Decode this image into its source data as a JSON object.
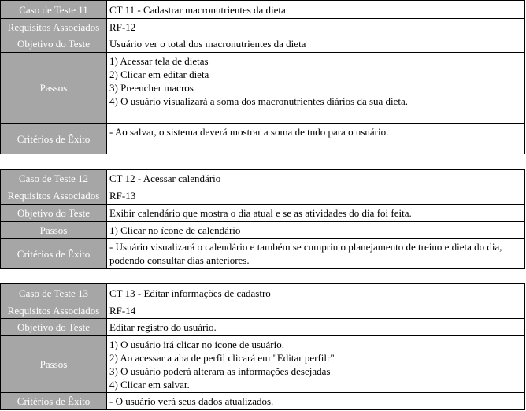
{
  "test_cases": [
    {
      "caso_label": "Caso de Teste 11",
      "caso_value": "CT 11 - Cadastrar macronutrientes da dieta",
      "requisitos_label": "Requisitos Associados",
      "requisitos_value": "RF-12",
      "objetivo_label": "Objetivo do Teste",
      "objetivo_value": "Usuário ver o total dos macronutrientes da dieta",
      "passos_label": "Passos",
      "passos": [
        "1) Acessar tela de dietas",
        "2) Clicar em editar dieta",
        "3) Preencher macros",
        "4) O usuário visualizará a soma dos macronutrientes diários da sua dieta."
      ],
      "criterios_label": "Critérios de Êxito",
      "criterios_value": "- Ao salvar, o sistema deverá mostrar a soma de tudo para o usuário."
    },
    {
      "caso_label": "Caso de Teste 12",
      "caso_value": "CT 12  - Acessar calendário",
      "requisitos_label": "Requisitos Associados",
      "requisitos_value": "RF-13",
      "objetivo_label": "Objetivo do Teste",
      "objetivo_value": "Exibir calendário que mostra o dia atual e se as atividades do dia foi feita.",
      "passos_label": "Passos",
      "passos": [
        "1) Clicar no ícone de calendário"
      ],
      "criterios_label": "Critérios de Êxito",
      "criterios_value": "- Usuário visualizará o calendário e também se cumpriu o planejamento de treino e dieta do dia, podendo consultar dias anteriores."
    },
    {
      "caso_label": "Caso de Teste 13",
      "caso_value": "CT 13 - Editar informações de cadastro",
      "requisitos_label": "Requisitos Associados",
      "requisitos_value": "RF-14",
      "objetivo_label": "Objetivo do Teste",
      "objetivo_value": "Editar registro do usuário.",
      "passos_label": "Passos",
      "passos": [
        "1) O usuário irá clicar no ícone de usuário.",
        "2) Ao acessar a aba de perfil clicará em \"Editar perfilr\"",
        "3) O usuário poderá alterara as informações desejadas",
        "4) Clicar em salvar."
      ],
      "criterios_label": "Critérios de Êxito",
      "criterios_value": "- O usuário verá seus dados atualizados."
    }
  ]
}
